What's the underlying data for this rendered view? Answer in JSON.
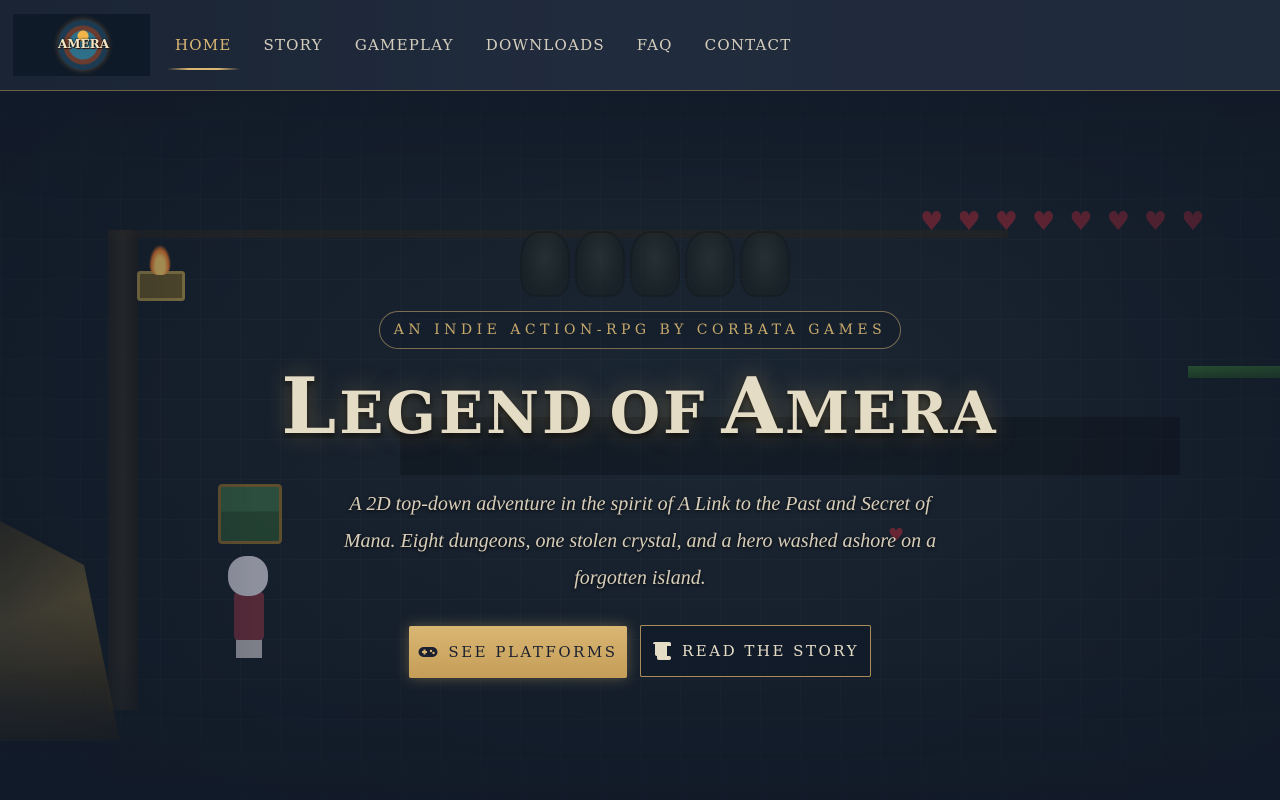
{
  "nav": {
    "logo_text": "AMERA",
    "links": [
      {
        "label": "HOME",
        "active": true
      },
      {
        "label": "STORY",
        "active": false
      },
      {
        "label": "GAMEPLAY",
        "active": false
      },
      {
        "label": "DOWNLOADS",
        "active": false
      },
      {
        "label": "FAQ",
        "active": false
      },
      {
        "label": "CONTACT",
        "active": false
      }
    ]
  },
  "hero": {
    "tagline": "AN INDIE ACTION-RPG BY CORBATA GAMES",
    "title": "Legend of Amera",
    "title_parts": {
      "w1_cap": "L",
      "w1_rest": "EGEND",
      "w2": "OF",
      "w3_cap": "A",
      "w3_rest": "MERA"
    },
    "subtitle": "A 2D top-down adventure in the spirit of A Link to the Past and Secret of Mana. Eight dungeons, one stolen crystal, and a hero washed ashore on a forgotten island.",
    "primary_button": {
      "label": "SEE PLATFORMS",
      "icon": "gamepad-icon"
    },
    "secondary_button": {
      "label": "READ THE STORY",
      "icon": "scroll-icon"
    },
    "hearts": [
      "♥",
      "♥",
      "♥",
      "♥",
      "♥",
      "♥",
      "♥",
      "♥"
    ]
  },
  "colors": {
    "accent_gold": "#d9b673",
    "background": "#111a28",
    "title_text": "#e5dcc6"
  }
}
